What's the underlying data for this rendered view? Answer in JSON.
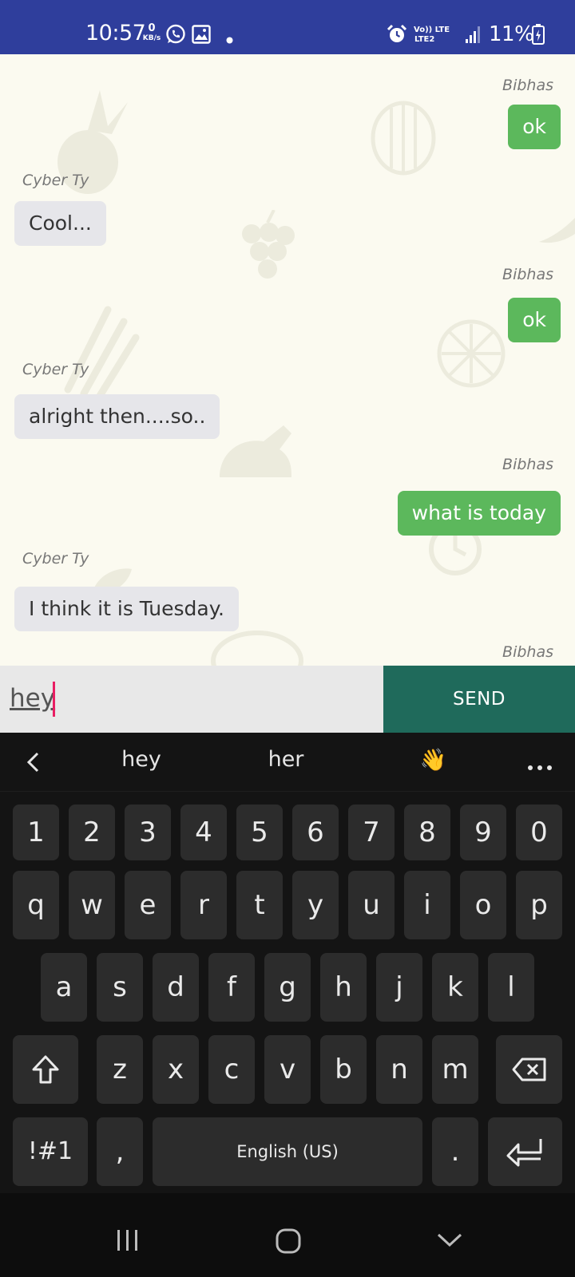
{
  "status_bar": {
    "time": "10:57",
    "net_speed_value": "0",
    "net_speed_unit": "KB/s",
    "network_label_top": "Vo)) LTE",
    "network_label_bottom": "LTE2",
    "battery": "11%",
    "icons": [
      "whatsapp-icon",
      "gallery-icon",
      "dot-icon",
      "alarm-icon",
      "signal-icon",
      "battery-icon"
    ]
  },
  "chat": {
    "messages": [
      {
        "sender": "Bibhas",
        "text": "ok",
        "direction": "out"
      },
      {
        "sender": "Cyber Ty",
        "text": "Cool...",
        "direction": "in"
      },
      {
        "sender": "Bibhas",
        "text": "ok",
        "direction": "out"
      },
      {
        "sender": "Cyber Ty",
        "text": "alright then....so..",
        "direction": "in"
      },
      {
        "sender": "Bibhas",
        "text": "what is today",
        "direction": "out"
      },
      {
        "sender": "Cyber Ty",
        "text": "I think it is Tuesday.",
        "direction": "in"
      },
      {
        "sender": "Bibhas",
        "text": "",
        "direction": "out"
      }
    ]
  },
  "input": {
    "value": "hey",
    "send_label": "SEND"
  },
  "keyboard": {
    "suggestions": [
      "hey",
      "her",
      "👋"
    ],
    "number_row": [
      "1",
      "2",
      "3",
      "4",
      "5",
      "6",
      "7",
      "8",
      "9",
      "0"
    ],
    "row1": [
      "q",
      "w",
      "e",
      "r",
      "t",
      "y",
      "u",
      "i",
      "o",
      "p"
    ],
    "row2": [
      "a",
      "s",
      "d",
      "f",
      "g",
      "h",
      "j",
      "k",
      "l"
    ],
    "row3": [
      "z",
      "x",
      "c",
      "v",
      "b",
      "n",
      "m"
    ],
    "symbols_label": "!#1",
    "comma_label": ",",
    "space_label": "English (US)",
    "period_label": "."
  },
  "colors": {
    "status_bar": "#2f3e9c",
    "outgoing_bubble": "#5cb85c",
    "incoming_bubble": "#e6e6ea",
    "send_button": "#1f6a5b",
    "caret": "#e91e63"
  }
}
